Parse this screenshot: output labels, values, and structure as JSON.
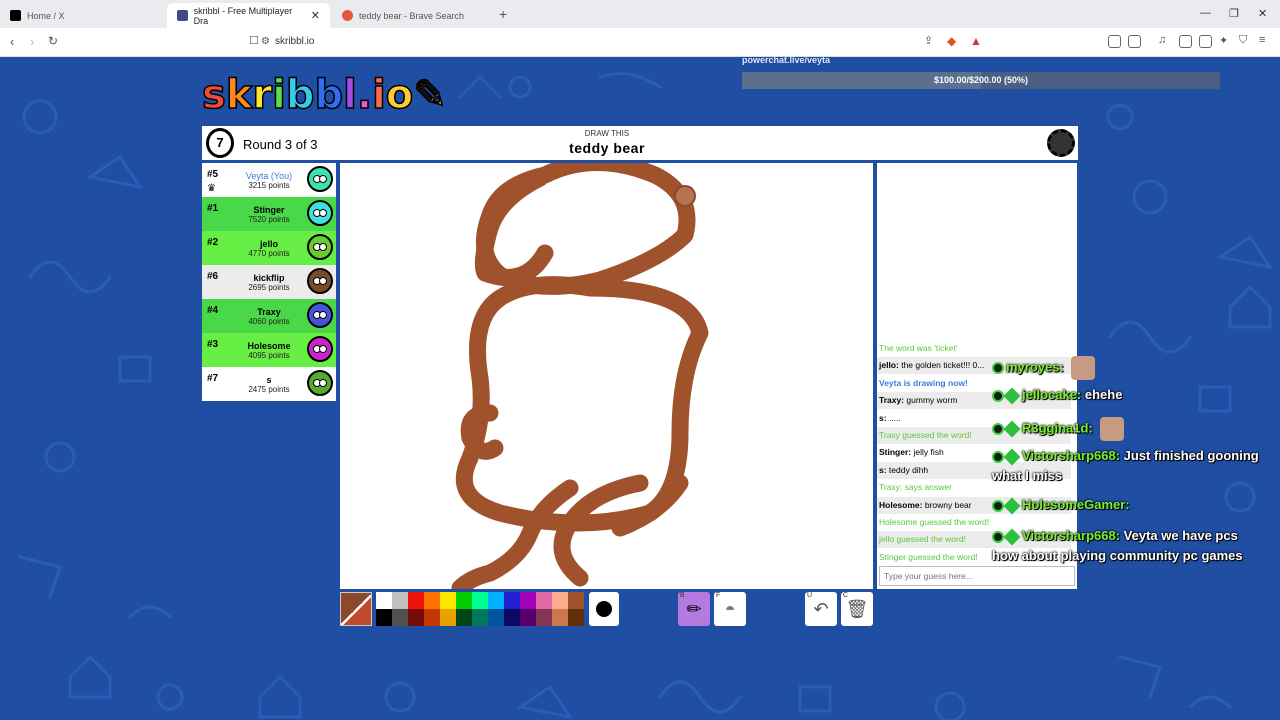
{
  "browser": {
    "tabs": [
      {
        "title": "Home / X",
        "active": false
      },
      {
        "title": "skribbl - Free Multiplayer Dra",
        "active": true
      },
      {
        "title": "teddy bear - Brave Search",
        "active": false
      }
    ],
    "url": "skribbl.io"
  },
  "overlay": {
    "powerchat_label": "powerchat.live/veyta",
    "goal_text": "$100.00/$200.00 (50%)",
    "goal_progress": 0.5
  },
  "game": {
    "logo": "skribbl.io",
    "timer": "7",
    "round": "Round 3 of 3",
    "draw_this": "DRAW THIS",
    "word": "teddy bear",
    "brush_color": "#a0522d"
  },
  "players": [
    {
      "rank": "#5",
      "name": "Veyta (You)",
      "points": "3215 points",
      "bg": "#ffffff",
      "avatar": "#3fe0b0",
      "you": true
    },
    {
      "rank": "#1",
      "name": "Stinger",
      "points": "7520 points",
      "bg": "#48d848",
      "avatar": "#40e0e0",
      "you": false
    },
    {
      "rank": "#2",
      "name": "jello",
      "points": "4770 points",
      "bg": "#66ee44",
      "avatar": "#66cc33",
      "you": false
    },
    {
      "rank": "#6",
      "name": "kickflip",
      "points": "2695 points",
      "bg": "#ececec",
      "avatar": "#7a4a2a",
      "you": false
    },
    {
      "rank": "#4",
      "name": "Traxy",
      "points": "4060 points",
      "bg": "#48d848",
      "avatar": "#4455dd",
      "you": false
    },
    {
      "rank": "#3",
      "name": "Holesome",
      "points": "4095 points",
      "bg": "#66ee44",
      "avatar": "#cc22cc",
      "you": false
    },
    {
      "rank": "#7",
      "name": "s",
      "points": "2475 points",
      "bg": "#ffffff",
      "avatar": "#55aa33",
      "you": false
    }
  ],
  "chat": {
    "messages": [
      {
        "type": "sys",
        "text": "The word was 'ticket'"
      },
      {
        "type": "user",
        "name": "jello:",
        "text": " the golden ticket!!! 0..."
      },
      {
        "type": "blue",
        "text": "Veyta is drawing now!"
      },
      {
        "type": "user",
        "name": "Traxy:",
        "text": " gummy worm"
      },
      {
        "type": "user",
        "name": "s:",
        "text": " ....."
      },
      {
        "type": "sys",
        "text": "Traxy guessed the word!"
      },
      {
        "type": "user",
        "name": "Stinger:",
        "text": " jelly fish"
      },
      {
        "type": "user",
        "name": "s:",
        "text": " teddy dihh"
      },
      {
        "type": "sys",
        "text": "Traxy: says answer"
      },
      {
        "type": "user",
        "name": "Holesome:",
        "text": " browny bear"
      },
      {
        "type": "sys",
        "text": "Holesome guessed the word!"
      },
      {
        "type": "sys",
        "text": "jello guessed the word!"
      },
      {
        "type": "sys",
        "text": "Stinger guessed the word!"
      }
    ],
    "input_placeholder": "Type your guess here..."
  },
  "palette": [
    "#ffffff",
    "#c1c1c1",
    "#ef130b",
    "#ff7100",
    "#ffe400",
    "#00cc00",
    "#00ff91",
    "#00b2ff",
    "#231fd3",
    "#a300ba",
    "#df69a7",
    "#ffac8e",
    "#a0522d",
    "#000000",
    "#505050",
    "#740b07",
    "#c23800",
    "#e8a200",
    "#004619",
    "#00785d",
    "#00569e",
    "#0e0865",
    "#550069",
    "#873554",
    "#cc774d",
    "#63300d"
  ],
  "tools": {
    "pencil_key": "B",
    "fill_key": "F",
    "undo_key": "U",
    "clear_key": "C"
  },
  "stream_chat": [
    {
      "user": "myroyes:",
      "text": ""
    },
    {
      "user": "jellocake:",
      "text": "ehehe"
    },
    {
      "user": "R3ggina1d:",
      "text": ""
    },
    {
      "user": "Victorsharp668:",
      "text": "Just finished gooning"
    },
    {
      "user": "",
      "text": "what I miss"
    },
    {
      "user": "HolesomeGamer:",
      "text": ""
    },
    {
      "user": "Victorsharp668:",
      "text": "Veyta we have pcs"
    },
    {
      "user": "",
      "text": "how about playing community pc games"
    }
  ]
}
